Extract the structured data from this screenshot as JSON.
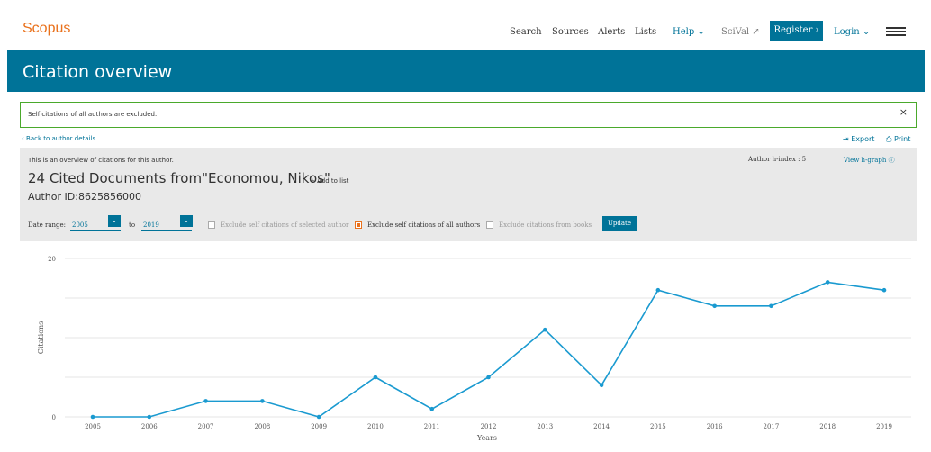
{
  "nav": {
    "logo": "Scopus",
    "search": "Search",
    "sources": "Sources",
    "alerts": "Alerts",
    "lists": "Lists",
    "help": "Help ⌄",
    "scival": "SciVal ↗",
    "register": "Register ›",
    "login": "Login ⌄"
  },
  "banner": {
    "title": "Citation overview"
  },
  "notice": {
    "text": "Self citations of all authors are excluded.",
    "close": "×"
  },
  "links": {
    "back": "‹ Back to author details",
    "export": "⇥ Export",
    "print": "⎙ Print"
  },
  "panel": {
    "overview": "This is an overview of citations for this author.",
    "h_index": "Author h-index : 5",
    "view_hgraph": "View h-graph ⓘ",
    "title": "24 Cited Documents from\"Economou, Nikos\"",
    "add_list": "+ Add to list",
    "author_id": "Author ID:8625856000",
    "date_range_label": "Date range:",
    "from_year": "2005",
    "to_label": "to",
    "to_year": "2019",
    "cb1": "Exclude self citations of selected author",
    "cb2": "Exclude self citations of all authors",
    "cb3": "Exclude citations from books",
    "update": "Update"
  },
  "colors": {
    "accent": "#007398",
    "brand": "#e9711c",
    "notice_border": "#4aa92c"
  },
  "chart_data": {
    "type": "line",
    "xlabel": "Years",
    "ylabel": "Citations",
    "ylim": [
      0,
      20
    ],
    "ytick_labels": [
      "0",
      "20"
    ],
    "x": [
      "2005",
      "2006",
      "2007",
      "2008",
      "2009",
      "2010",
      "2011",
      "2012",
      "2013",
      "2014",
      "2015",
      "2016",
      "2017",
      "2018",
      "2019"
    ],
    "series": [
      {
        "values": [
          0,
          0,
          2,
          2,
          0,
          5,
          1,
          5,
          11,
          4,
          16,
          14,
          14,
          17,
          16
        ]
      }
    ],
    "grid": true,
    "color": "#1a9ad0"
  }
}
